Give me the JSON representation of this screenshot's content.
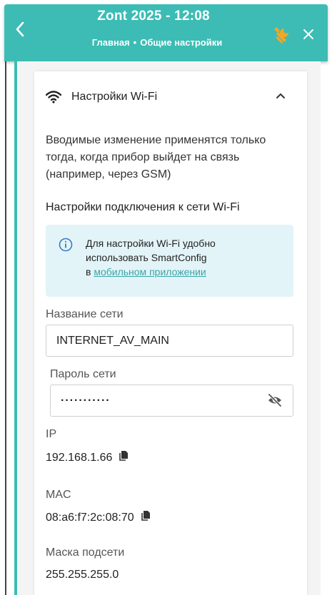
{
  "header": {
    "title": "Zont 2025 - 12:08",
    "breadcrumb_home": "Главная",
    "breadcrumb_separator": "•",
    "breadcrumb_current": "Общие настройки",
    "accent_color": "#3cbcb4",
    "icons": [
      "chevron-left-icon",
      "wrench-icon",
      "close-icon"
    ]
  },
  "section": {
    "title": "Настройки Wi-Fi",
    "icon": "wifi-icon",
    "expanded": true
  },
  "notice": "Вводимые изменение применятся только тогда, когда прибор выйдет на связь (например, через GSM)",
  "subtitle": "Настройки подключения к сети Wi-Fi",
  "info": {
    "line1": "Для настройки Wi-Fi удобно",
    "line2": "использовать SmartConfig",
    "prefix": "в",
    "link": "мобильном приложении",
    "link_color": "#3aa5a6",
    "background": "#e3f4f8"
  },
  "network": {
    "label": "Название сети",
    "value": "INTERNET_AV_MAIN"
  },
  "password": {
    "label": "Пароль сети",
    "masked_value": "···········"
  },
  "ip": {
    "label": "IP",
    "value": "192.168.1.66"
  },
  "mac": {
    "label": "MAC",
    "value": "08:a6:f7:2c:08:70"
  },
  "subnet": {
    "label": "Маска подсети",
    "value": "255.255.255.0"
  }
}
